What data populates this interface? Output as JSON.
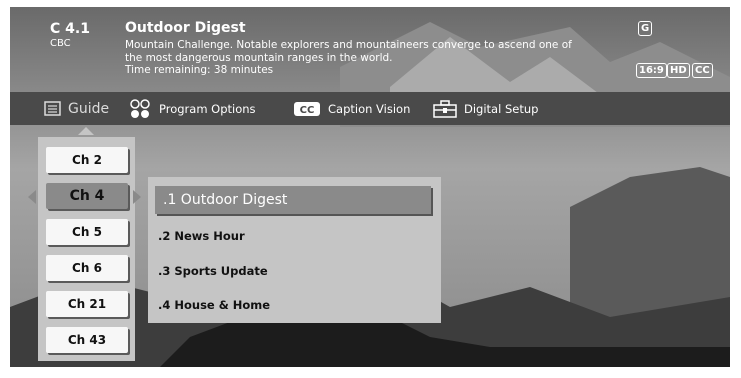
{
  "banner": {
    "channel_number": "C 4.1",
    "network": "CBC",
    "program_title": "Outdoor Digest",
    "description": "Mountain Challenge. Notable explorers and mountaineers converge to ascend one of the most dangerous mountain ranges in the world.",
    "time_remaining": "Time remaining: 38 minutes",
    "rating_badge": "G",
    "format_badges": [
      "16:9",
      "HD",
      "CC"
    ]
  },
  "menu": {
    "guide": "Guide",
    "program_options": "Program Options",
    "caption_vision": "Caption Vision",
    "digital_setup": "Digital Setup",
    "cc_icon_text": "CC"
  },
  "channels": [
    "Ch 2",
    "Ch 4",
    "Ch 5",
    "Ch 6",
    "Ch 21",
    "Ch 43"
  ],
  "selected_channel": "Ch 4",
  "subchannels": [
    ".1  Outdoor Digest",
    ".2 News Hour",
    ".3 Sports Update",
    ".4 House & Home"
  ],
  "colors": {
    "menubar": "#4a4a4a",
    "panel": "#c5c5c5",
    "selected": "#8a8a8a"
  }
}
